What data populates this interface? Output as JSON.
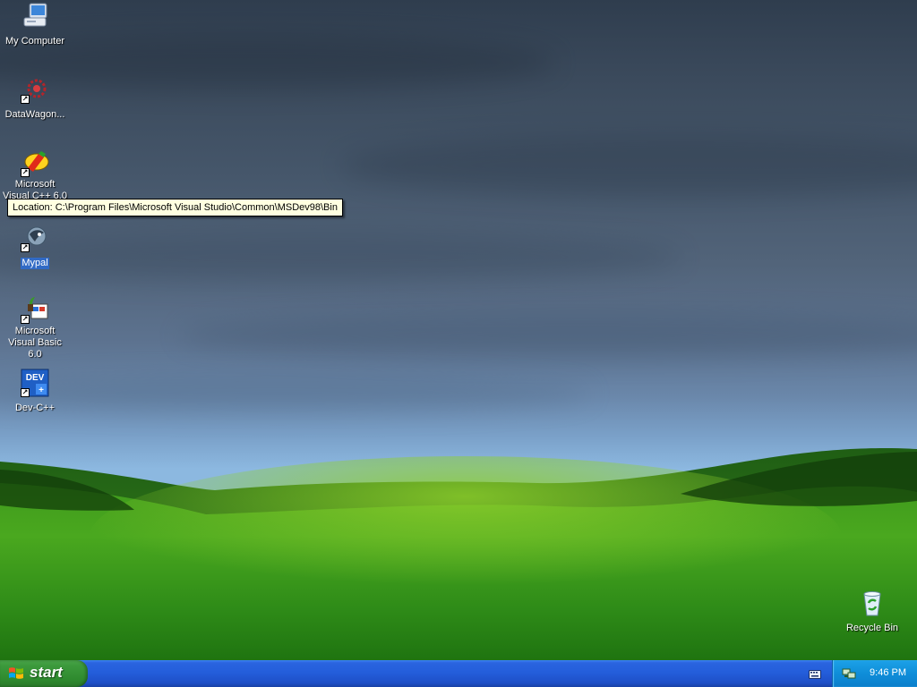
{
  "desktop": {
    "icons": [
      {
        "label": "My Computer"
      },
      {
        "label": "DataWagon..."
      },
      {
        "label": "Microsoft Visual C++ 6.0"
      },
      {
        "label": "Mypal"
      },
      {
        "label": "Microsoft Visual Basic 6.0"
      },
      {
        "label": "Dev-C++"
      },
      {
        "label": "Recycle Bin"
      }
    ],
    "tooltip": "Location: C:\\Program Files\\Microsoft Visual Studio\\Common\\MSDev98\\Bin"
  },
  "taskbar": {
    "start_label": "start",
    "clock": "9:46 PM"
  },
  "colors": {
    "taskbar": "#245edb",
    "start_button": "#3c9a3c",
    "tray": "#0f8ed9",
    "tooltip_bg": "#ffffe1",
    "selection": "#316ac5"
  },
  "icon_names": {
    "my_computer": "computer-icon",
    "datawagon": "datawagon-icon",
    "vcpp": "visual-cpp-icon",
    "mypal": "mypal-icon",
    "vb": "visual-basic-icon",
    "devcpp": "dev-cpp-icon",
    "recycle": "recycle-bin-icon",
    "keyboard": "keyboard-icon",
    "network": "network-icon"
  }
}
